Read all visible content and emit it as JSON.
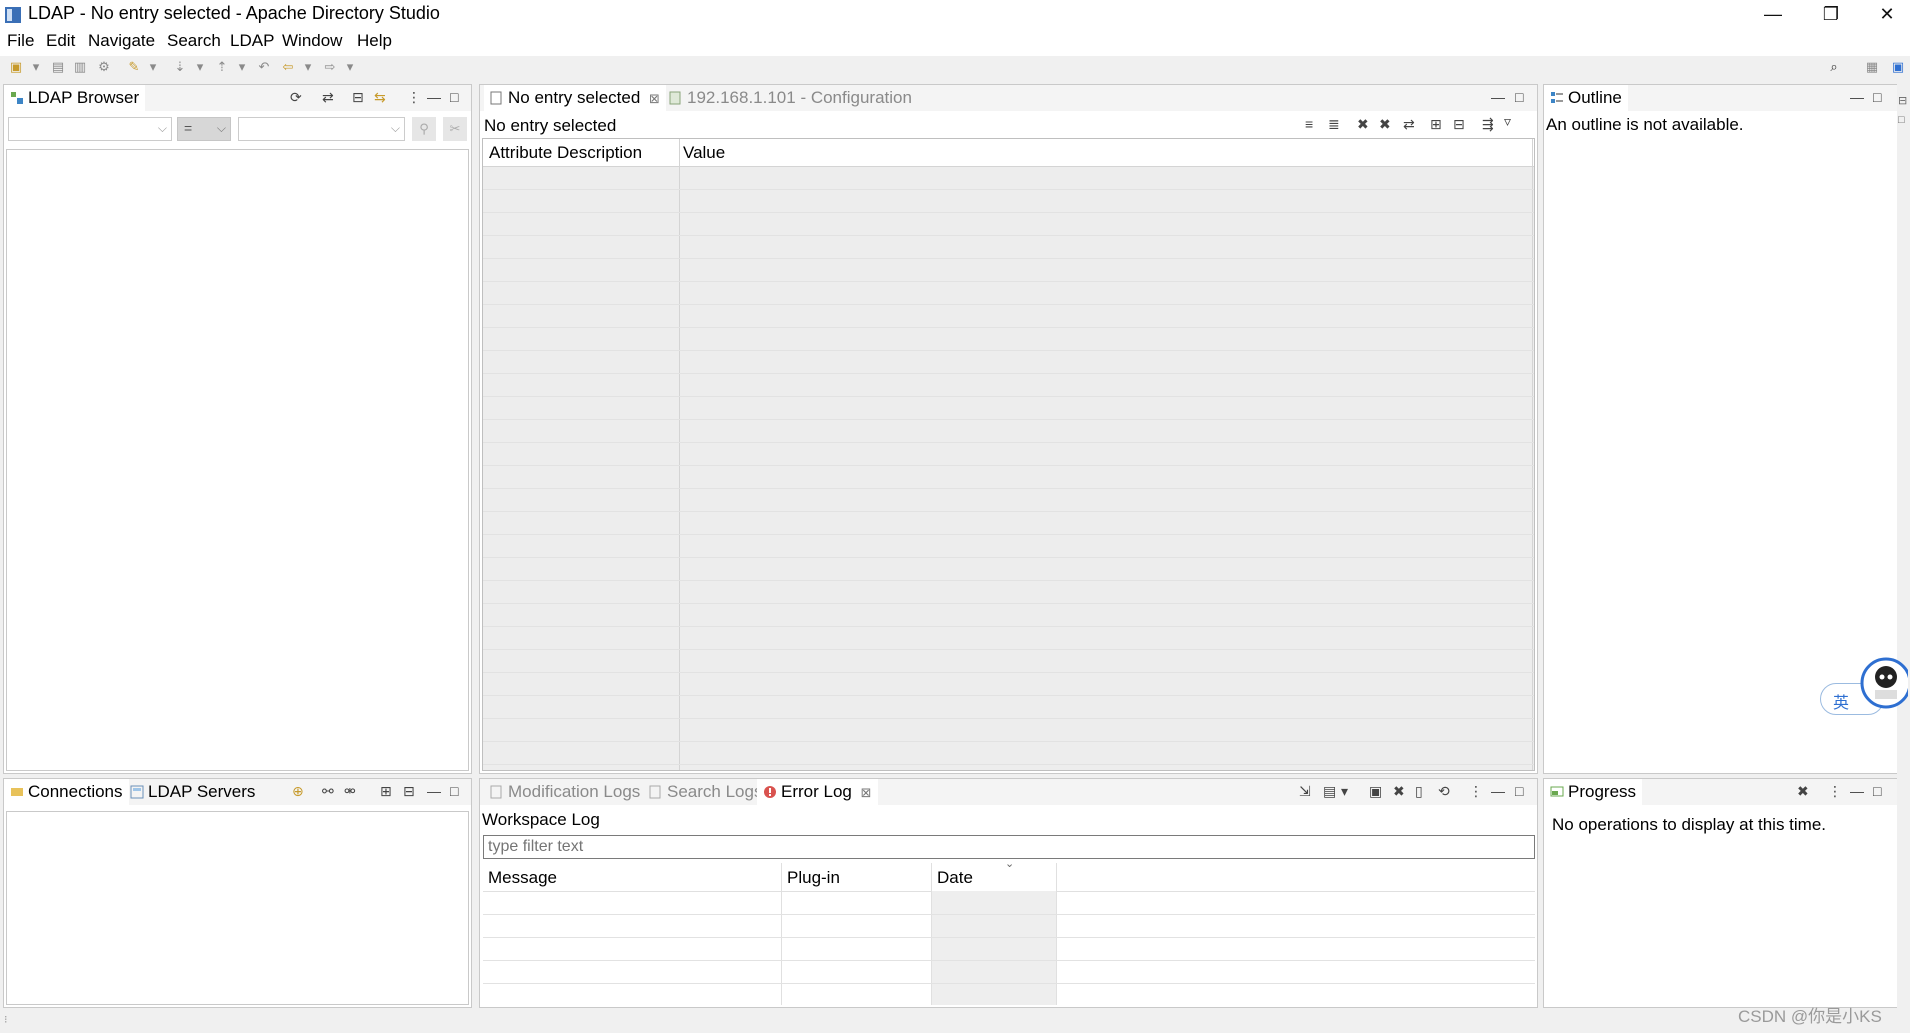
{
  "window": {
    "title": "LDAP - No entry selected - Apache Directory Studio",
    "minimize": "—",
    "restore": "❐",
    "close": "✕"
  },
  "menu": [
    "File",
    "Edit",
    "Navigate",
    "Search",
    "LDAP",
    "Window",
    "Help"
  ],
  "ldap_browser": {
    "tab": "LDAP Browser",
    "operator": "="
  },
  "editor": {
    "tabs": [
      {
        "label": "No entry selected",
        "close": "⊠"
      },
      {
        "label": "192.168.1.101 - Configuration"
      }
    ],
    "heading": "No entry selected",
    "columns": [
      "Attribute Description",
      "Value"
    ]
  },
  "outline": {
    "tab": "Outline",
    "message": "An outline is not available."
  },
  "connections": {
    "tabs": [
      "Connections",
      "LDAP Servers"
    ]
  },
  "logs": {
    "tabs": [
      "Modification Logs",
      "Search Logs",
      "Error Log"
    ],
    "close": "⊠",
    "heading": "Workspace Log",
    "filter_placeholder": "type filter text",
    "columns": [
      "Message",
      "Plug-in",
      "Date"
    ]
  },
  "progress": {
    "tab": "Progress",
    "message": "No operations to display at this time."
  },
  "ime_badge": "英",
  "watermark": "CSDN @你是小KS",
  "colors": {
    "grid_bg": "#ededed",
    "panel_border": "#c9c9c9",
    "active_tab": "#ffffff",
    "accent_blue": "#2e6fd1"
  }
}
